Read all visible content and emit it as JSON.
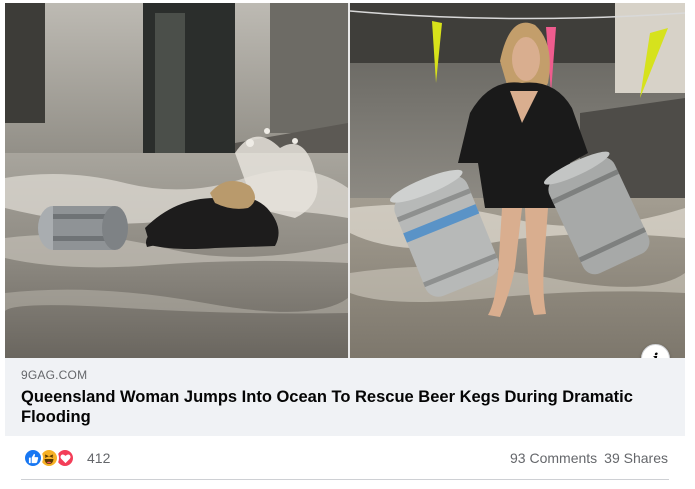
{
  "link_preview": {
    "domain": "9GAG.COM",
    "title": "Queensland Woman Jumps Into Ocean To Rescue Beer Kegs During Dramatic Flooding",
    "info_button": "i"
  },
  "reactions": {
    "icons": [
      "like-icon",
      "haha-icon",
      "love-icon"
    ],
    "count": "412"
  },
  "stats": {
    "comments": "93 Comments",
    "shares": "39 Shares"
  },
  "colors": {
    "like": "#1877f2",
    "haha": "#f7b125",
    "love": "#f33e58",
    "link_background": "#f0f2f5",
    "secondary_text": "#65676b"
  }
}
